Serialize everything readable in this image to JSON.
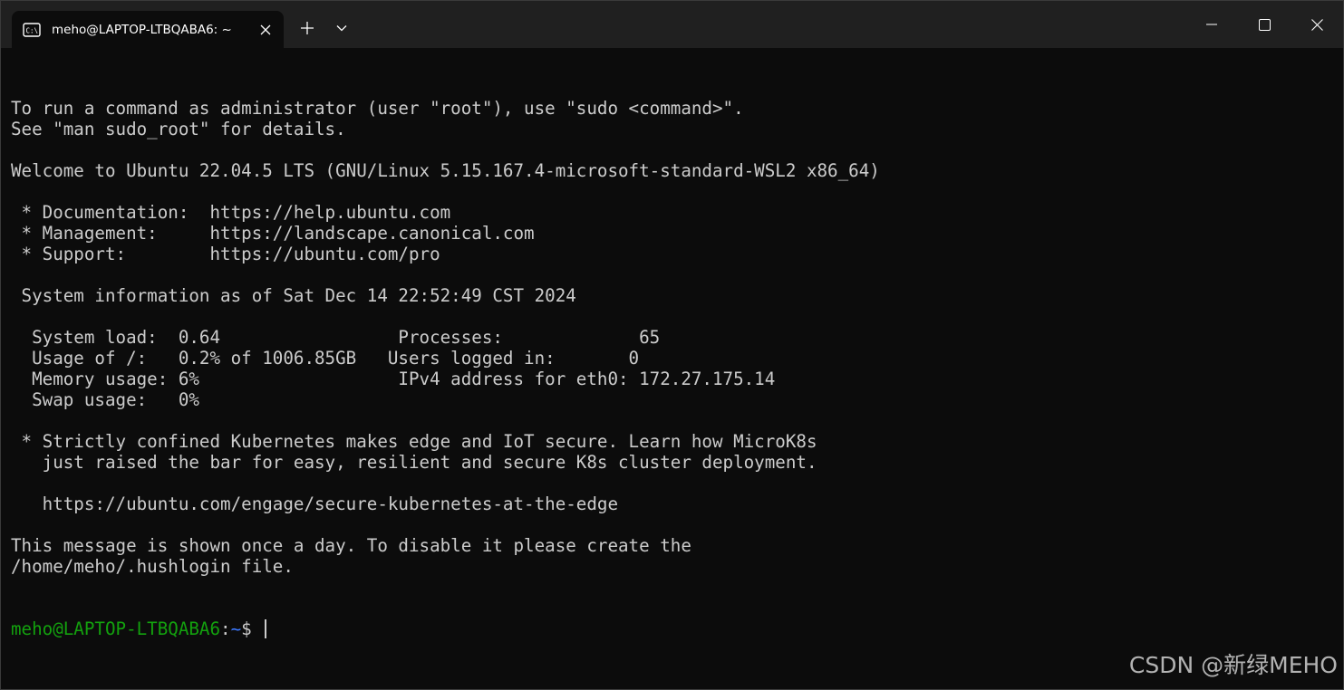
{
  "tab": {
    "title": "meho@LAPTOP-LTBQABA6: ~",
    "icon": "terminal-icon"
  },
  "titlebar": {
    "new_tab_icon": "plus-icon",
    "dropdown_icon": "chevron-down-icon",
    "minimize_icon": "minimize-icon",
    "maximize_icon": "maximize-icon",
    "close_icon": "close-icon"
  },
  "terminal": {
    "lines": [
      "To run a command as administrator (user \"root\"), use \"sudo <command>\".",
      "See \"man sudo_root\" for details.",
      "",
      "Welcome to Ubuntu 22.04.5 LTS (GNU/Linux 5.15.167.4-microsoft-standard-WSL2 x86_64)",
      "",
      " * Documentation:  https://help.ubuntu.com",
      " * Management:     https://landscape.canonical.com",
      " * Support:        https://ubuntu.com/pro",
      "",
      " System information as of Sat Dec 14 22:52:49 CST 2024",
      "",
      "  System load:  0.64                 Processes:             65",
      "  Usage of /:   0.2% of 1006.85GB   Users logged in:       0",
      "  Memory usage: 6%                   IPv4 address for eth0: 172.27.175.14",
      "  Swap usage:   0%",
      "",
      " * Strictly confined Kubernetes makes edge and IoT secure. Learn how MicroK8s",
      "   just raised the bar for easy, resilient and secure K8s cluster deployment.",
      "",
      "   https://ubuntu.com/engage/secure-kubernetes-at-the-edge",
      "",
      "This message is shown once a day. To disable it please create the",
      "/home/meho/.hushlogin file."
    ],
    "prompt": {
      "user_host": "meho@LAPTOP-LTBQABA6",
      "colon": ":",
      "path": "~",
      "symbol": "$"
    },
    "colors": {
      "background": "#0c0c0c",
      "foreground": "#cccccc",
      "user_host": "#13a10e",
      "path": "#3b78ff"
    }
  },
  "watermark": "CSDN @新绿MEHO"
}
